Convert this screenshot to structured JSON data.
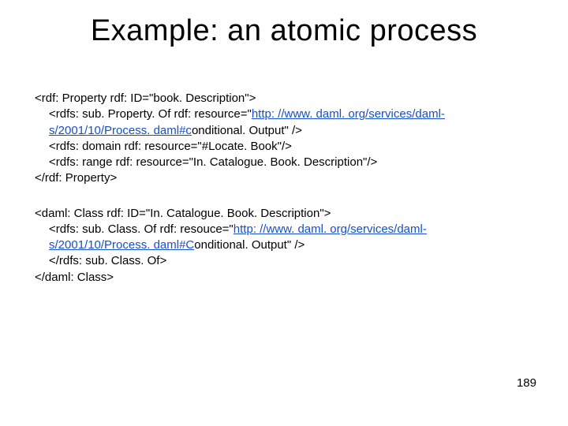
{
  "title": "Example: an atomic process",
  "block1": {
    "l1a": "<rdf: Property rdf: ID=\"book. Description\">",
    "l2a": "<rdfs: sub. Property. Of rdf: resource=\"",
    "l2link": "http: //www. daml. org/services/daml-s/2001/10/Process. daml#c",
    "l2b": "onditional. Output\" />",
    "l3": "<rdfs: domain rdf: resource=\"#Locate. Book\"/>",
    "l4": "<rdfs: range rdf: resource=\"In. Catalogue. Book. Description\"/>",
    "l5": "</rdf: Property>"
  },
  "block2": {
    "l1": "<daml: Class rdf: ID=\"In. Catalogue. Book. Description\">",
    "l2a": "<rdfs: sub. Class. Of rdf: resouce=\"",
    "l2link": "http: //www. daml. org/services/daml-s/2001/10/Process. daml#C",
    "l2b": "onditional. Output\" />",
    "l3": "</rdfs: sub. Class. Of>",
    "l4": "</daml: Class>"
  },
  "pagenum": "189"
}
